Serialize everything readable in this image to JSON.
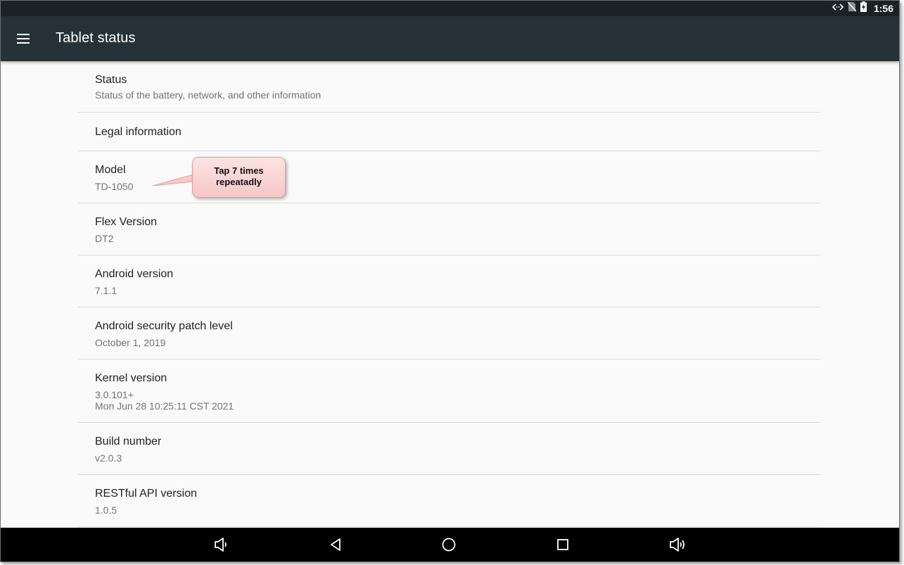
{
  "status_bar": {
    "time": "1:56",
    "icons": [
      "data-transfer-icon",
      "no-sim-icon",
      "battery-charging-icon"
    ]
  },
  "app_bar": {
    "menu_icon": "hamburger-menu-icon",
    "title": "Tablet status"
  },
  "settings": {
    "items": [
      {
        "title": "Status",
        "summary": "Status of the battery, network, and other information"
      },
      {
        "title": "Legal information"
      },
      {
        "title": "Model",
        "summary": "TD-1050"
      },
      {
        "title": "Flex Version",
        "summary": "DT2"
      },
      {
        "title": "Android version",
        "summary": "7.1.1"
      },
      {
        "title": "Android security patch level",
        "summary": "October 1, 2019"
      },
      {
        "title": "Kernel version",
        "summary": "3.0.101+",
        "summary_line2": "Mon Jun 28 10:25:11 CST 2021"
      },
      {
        "title": "Build number",
        "summary": "v2.0.3"
      },
      {
        "title": "RESTful API version",
        "summary": "1.0.5"
      }
    ]
  },
  "callout": {
    "text": "Tap 7 times\nrepeatadly",
    "fill_color": "#f9d2d2",
    "border_color": "#e79a9a"
  },
  "nav_bar": {
    "buttons": [
      "volume-down-icon",
      "back-icon",
      "home-icon",
      "recents-icon",
      "volume-up-icon"
    ]
  },
  "colors": {
    "app_bar": "#263238",
    "status_bar": "#1b2226",
    "background": "#fafafa",
    "nav_bar": "#000000"
  }
}
